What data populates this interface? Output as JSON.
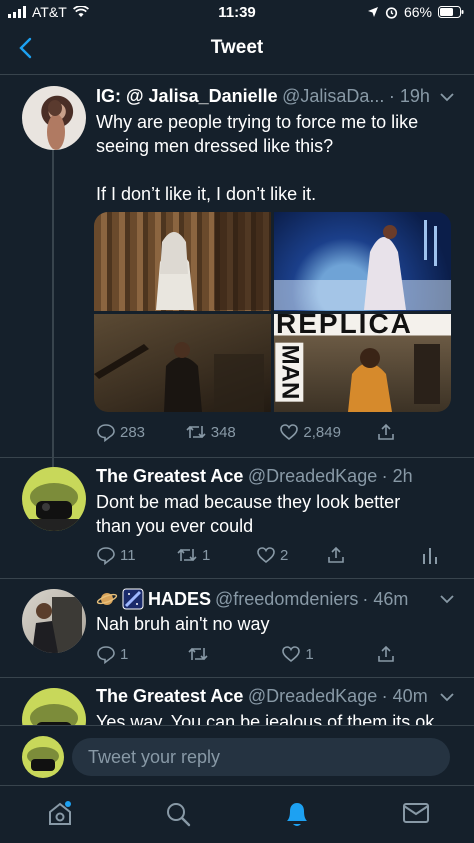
{
  "status_bar": {
    "carrier": "AT&T",
    "time": "11:39",
    "battery": "66%"
  },
  "header": {
    "title": "Tweet"
  },
  "main_tweet": {
    "name": "IG: @ Jalisa_Danielle",
    "handle": "@JalisaDa...",
    "time": "· 19h",
    "text_line1": "Why are people trying to force me to like",
    "text_line2": "seeing men dressed like this?",
    "text_line3": "If I don’t like it, I don’t like it.",
    "media_overlay_text": "REPLICA",
    "media_overlay_text2": "MAN",
    "replies": "283",
    "retweets": "348",
    "likes": "2,849"
  },
  "replies": [
    {
      "name": "The Greatest Ace",
      "handle": "@DreadedKage",
      "time": "· 2h",
      "text_line1": "Dont be mad because they look better",
      "text_line2": "than you ever could",
      "replies": "11",
      "retweets": "1",
      "likes": "2"
    },
    {
      "name": "HADES",
      "handle": "@freedomdeniers",
      "time": "· 46m",
      "text_line1": "Nah bruh ain't no way",
      "replies": "1",
      "retweets": "",
      "likes": "1"
    },
    {
      "name": "The Greatest Ace",
      "handle": "@DreadedKage",
      "time": "· 40m",
      "text_line1": "Yes way. You can be jealous of them its ok."
    }
  ],
  "reply_bar": {
    "placeholder": "Tweet your reply"
  },
  "colors": {
    "background": "#15202b",
    "accent": "#1da1f2",
    "muted": "#8899a6"
  }
}
